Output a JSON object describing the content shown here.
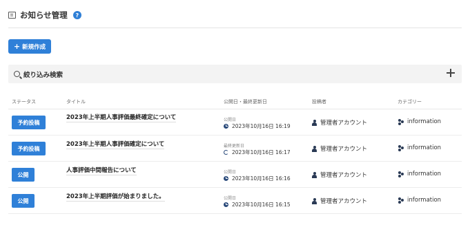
{
  "header": {
    "title": "お知らせ管理",
    "help": "?"
  },
  "toolbar": {
    "new_plus": "+",
    "new_label": "新規作成"
  },
  "filter": {
    "label": "絞り込み検索"
  },
  "columns": {
    "status": "ステータス",
    "title": "タイトル",
    "date": "公開日・最終更新日",
    "author": "投稿者",
    "category": "カテゴリー"
  },
  "rows": [
    {
      "status": "予約投稿",
      "title": "2023年上半期人事評価最終確定について",
      "date_label": "公開日",
      "date": "2023年10月16日 16:19",
      "date_icon": "clock-icon",
      "author": "管理者アカウント",
      "category": "information"
    },
    {
      "status": "予約投稿",
      "title": "2023年上半期人事評価確定について",
      "date_label": "最終更新日",
      "date": "2023年10月16日 16:17",
      "date_icon": "refresh-icon",
      "author": "管理者アカウント",
      "category": "information"
    },
    {
      "status": "公開",
      "title": "人事評価中間報告について",
      "date_label": "公開日",
      "date": "2023年10月16日 16:16",
      "date_icon": "clock-icon",
      "author": "管理者アカウント",
      "category": "information"
    },
    {
      "status": "公開",
      "title": "2023年上半期評価が始まりました。",
      "date_label": "公開日",
      "date": "2023年10月16日 16:15",
      "date_icon": "clock-icon",
      "author": "管理者アカウント",
      "category": "information"
    }
  ],
  "colors": {
    "accent": "#2f80d8",
    "icon_dark": "#2a3a55"
  }
}
